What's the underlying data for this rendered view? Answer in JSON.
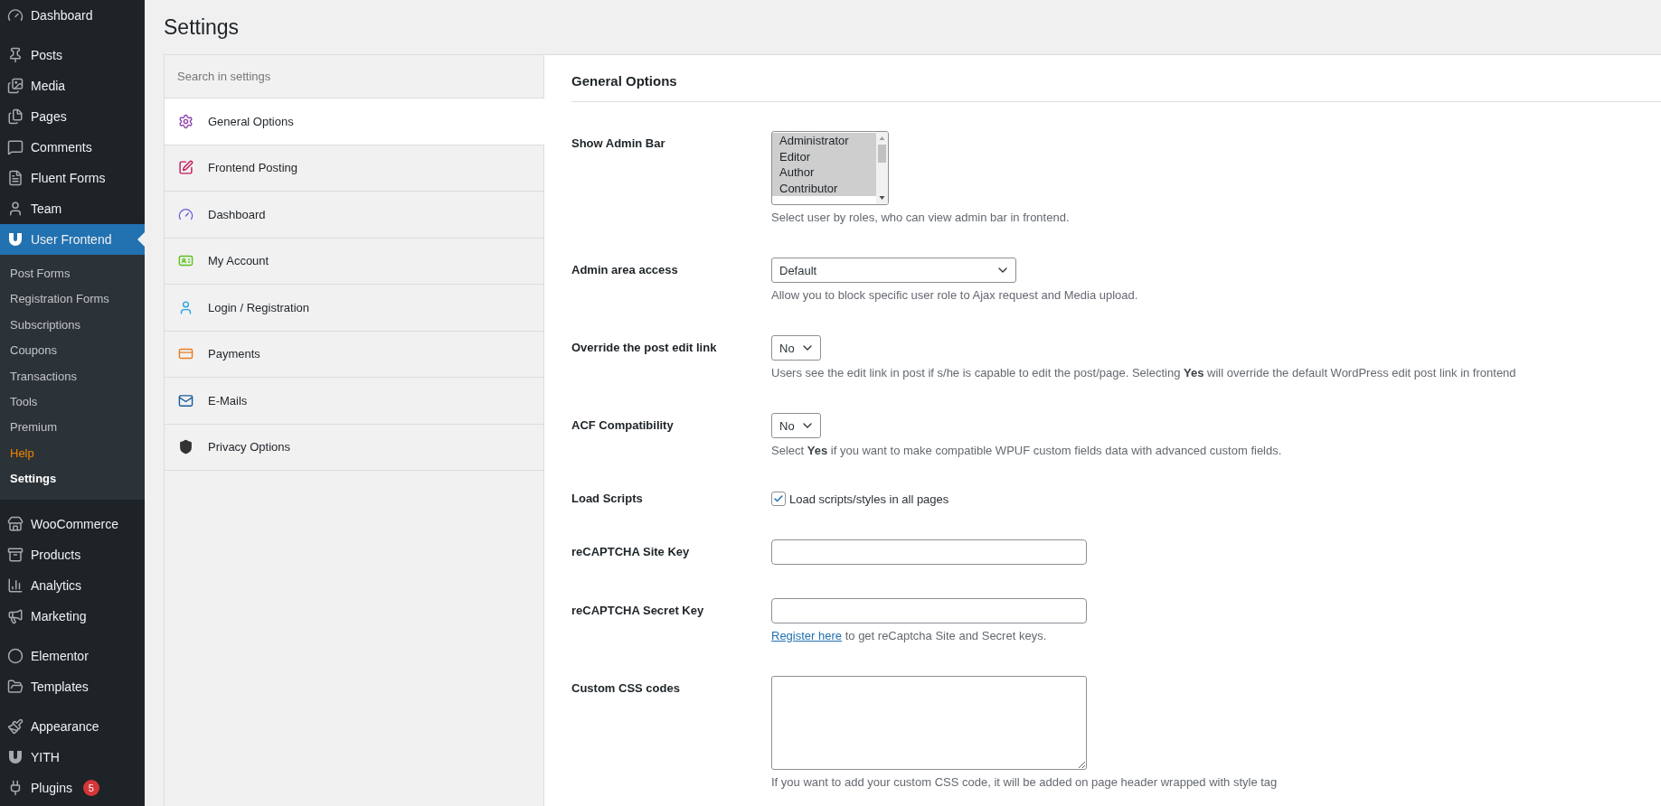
{
  "admin_menu": {
    "groups": [
      [
        {
          "label": "Dashboard",
          "selected": false
        }
      ],
      [
        {
          "label": "Posts",
          "selected": false
        },
        {
          "label": "Media",
          "selected": false
        },
        {
          "label": "Pages",
          "selected": false
        },
        {
          "label": "Comments",
          "selected": false
        },
        {
          "label": "Fluent Forms",
          "selected": false
        },
        {
          "label": "Team",
          "selected": false
        },
        {
          "label": "User Frontend",
          "selected": true,
          "submenu": [
            {
              "label": "Post Forms",
              "kind": "link",
              "selected": false
            },
            {
              "label": "Registration Forms",
              "kind": "link",
              "selected": false
            },
            {
              "label": "Subscriptions",
              "kind": "link",
              "selected": false
            },
            {
              "label": "Coupons",
              "kind": "link",
              "selected": false
            },
            {
              "label": "Transactions",
              "kind": "link",
              "selected": false
            },
            {
              "label": "Tools",
              "kind": "link",
              "selected": false
            },
            {
              "label": "Premium",
              "kind": "link",
              "selected": false
            },
            {
              "label": "Help",
              "kind": "highlight",
              "selected": false
            },
            {
              "label": "Settings",
              "kind": "link",
              "selected": true
            }
          ]
        }
      ],
      [
        {
          "label": "WooCommerce",
          "selected": false
        },
        {
          "label": "Products",
          "selected": false
        },
        {
          "label": "Analytics",
          "selected": false
        },
        {
          "label": "Marketing",
          "selected": false
        }
      ],
      [
        {
          "label": "Elementor",
          "selected": false
        },
        {
          "label": "Templates",
          "selected": false
        }
      ],
      [
        {
          "label": "Appearance",
          "selected": false
        },
        {
          "label": "YITH",
          "selected": false
        },
        {
          "label": "Plugins",
          "selected": false,
          "badge": "5"
        }
      ]
    ]
  },
  "page_title": "Settings",
  "settings_nav": {
    "search": {
      "placeholder": "Search in settings"
    },
    "items": [
      {
        "label": "General Options",
        "selected": true
      },
      {
        "label": "Frontend Posting",
        "selected": false
      },
      {
        "label": "Dashboard",
        "selected": false
      },
      {
        "label": "My Account",
        "selected": false
      },
      {
        "label": "Login / Registration",
        "selected": false
      },
      {
        "label": "Payments",
        "selected": false
      },
      {
        "label": "E-Mails",
        "selected": false
      },
      {
        "label": "Privacy Options",
        "selected": false
      }
    ]
  },
  "section_title": "General Options",
  "fields": [
    {
      "kind": "multiselect",
      "label": "Show Admin Bar",
      "options": [
        {
          "label": "Administrator",
          "selected": true
        },
        {
          "label": "Editor",
          "selected": true
        },
        {
          "label": "Author",
          "selected": true
        },
        {
          "label": "Contributor",
          "selected": true
        }
      ],
      "description": "Select user by roles, who can view admin bar in frontend."
    },
    {
      "kind": "select",
      "label": "Admin area access",
      "value": "Default",
      "wide": true,
      "description": "Allow you to block specific user role to Ajax request and Media upload."
    },
    {
      "kind": "select",
      "label": "Override the post edit link",
      "value": "No",
      "wide": false,
      "description": "Users see the edit link in post if s/he is capable to edit the post/page. Selecting **Yes** will override the default WordPress edit post link in frontend"
    },
    {
      "kind": "select",
      "label": "ACF Compatibility",
      "value": "No",
      "wide": false,
      "description": "Select **Yes** if you want to make compatible WPUF custom fields data with advanced custom fields."
    },
    {
      "kind": "checkbox",
      "label": "Load Scripts",
      "checked": true,
      "option_label": "Load scripts/styles in all pages"
    },
    {
      "kind": "text",
      "label": "reCAPTCHA Site Key"
    },
    {
      "kind": "text",
      "label": "reCAPTCHA Secret Key",
      "link": "Register here",
      "description": "to get reCaptcha Site and Secret keys."
    },
    {
      "kind": "textarea",
      "label": "Custom CSS codes",
      "description": "If you want to add your custom CSS code, it will be added on page header wrapped with style tag"
    }
  ]
}
